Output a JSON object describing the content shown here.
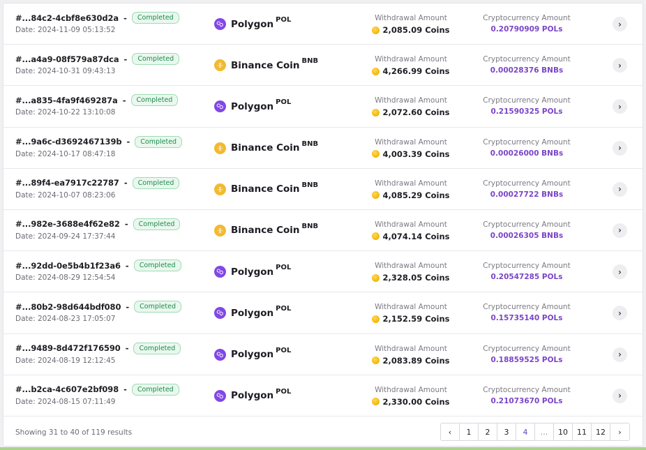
{
  "withdrawal_label": "Withdrawal Amount",
  "crypto_label": "Cryptocurrency Amount",
  "status_completed": "Completed",
  "colors": {
    "polygon": "#8247e5",
    "bnb": "#f3ba2f",
    "crypto_text": "#7a45c8",
    "badge_green": "#1f8a4c"
  },
  "rows": [
    {
      "id": "#...84c2-4cbf8e630d2a",
      "date": "Date: 2024-11-09 05:13:52",
      "network": "Polygon",
      "symbol": "POL",
      "icon": "polygon-icon",
      "coins": "2,085.09 Coins",
      "crypto": "0.20790909 POLs"
    },
    {
      "id": "#...a4a9-08f579a87dca",
      "date": "Date: 2024-10-31 09:43:13",
      "network": "Binance Coin",
      "symbol": "BNB",
      "icon": "bnb-icon",
      "coins": "4,266.99 Coins",
      "crypto": "0.00028376 BNBs"
    },
    {
      "id": "#...a835-4fa9f469287a",
      "date": "Date: 2024-10-22 13:10:08",
      "network": "Polygon",
      "symbol": "POL",
      "icon": "polygon-icon",
      "coins": "2,072.60 Coins",
      "crypto": "0.21590325 POLs"
    },
    {
      "id": "#...9a6c-d3692467139b",
      "date": "Date: 2024-10-17 08:47:18",
      "network": "Binance Coin",
      "symbol": "BNB",
      "icon": "bnb-icon",
      "coins": "4,003.39 Coins",
      "crypto": "0.00026000 BNBs"
    },
    {
      "id": "#...89f4-ea7917c22787",
      "date": "Date: 2024-10-07 08:23:06",
      "network": "Binance Coin",
      "symbol": "BNB",
      "icon": "bnb-icon",
      "coins": "4,085.29 Coins",
      "crypto": "0.00027722 BNBs"
    },
    {
      "id": "#...982e-3688e4f62e82",
      "date": "Date: 2024-09-24 17:37:44",
      "network": "Binance Coin",
      "symbol": "BNB",
      "icon": "bnb-icon",
      "coins": "4,074.14 Coins",
      "crypto": "0.00026305 BNBs"
    },
    {
      "id": "#...92dd-0e5b4b1f23a6",
      "date": "Date: 2024-08-29 12:54:54",
      "network": "Polygon",
      "symbol": "POL",
      "icon": "polygon-icon",
      "coins": "2,328.05 Coins",
      "crypto": "0.20547285 POLs"
    },
    {
      "id": "#...80b2-98d644bdf080",
      "date": "Date: 2024-08-23 17:05:07",
      "network": "Polygon",
      "symbol": "POL",
      "icon": "polygon-icon",
      "coins": "2,152.59 Coins",
      "crypto": "0.15735140 POLs"
    },
    {
      "id": "#...9489-8d472f176590",
      "date": "Date: 2024-08-19 12:12:45",
      "network": "Polygon",
      "symbol": "POL",
      "icon": "polygon-icon",
      "coins": "2,083.89 Coins",
      "crypto": "0.18859525 POLs"
    },
    {
      "id": "#...b2ca-4c607e2bf098",
      "date": "Date: 2024-08-15 07:11:49",
      "network": "Polygon",
      "symbol": "POL",
      "icon": "polygon-icon",
      "coins": "2,330.00 Coins",
      "crypto": "0.21073670 POLs"
    }
  ],
  "footer": {
    "showing": "Showing 31 to 40 of 119 results",
    "pages": [
      {
        "label": "‹",
        "name": "prev-page-button"
      },
      {
        "label": "1"
      },
      {
        "label": "2"
      },
      {
        "label": "3"
      },
      {
        "label": "4",
        "active": true
      },
      {
        "label": "...",
        "ellipsis": true
      },
      {
        "label": "10"
      },
      {
        "label": "11"
      },
      {
        "label": "12"
      },
      {
        "label": "›",
        "name": "next-page-button"
      }
    ]
  }
}
